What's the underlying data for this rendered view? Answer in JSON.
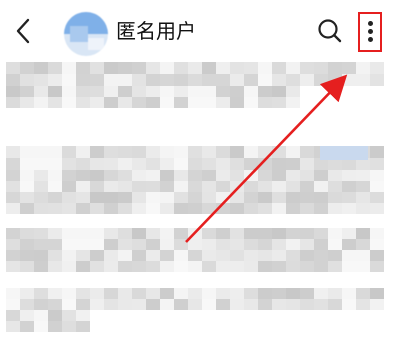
{
  "header": {
    "username": "匿名用户",
    "back_icon": "chevron-left-icon",
    "search_icon": "search-icon",
    "more_icon": "more-vertical-icon"
  },
  "highlight": {
    "box_color": "#e51f1f",
    "arrow_color": "#e51f1f"
  }
}
